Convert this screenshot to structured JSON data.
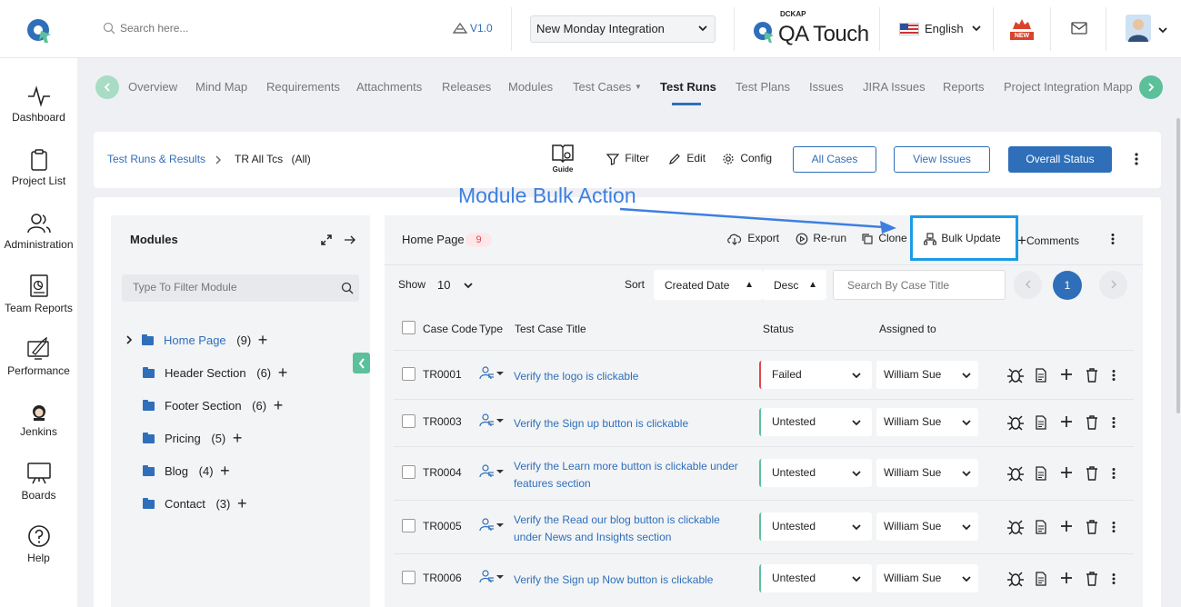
{
  "topbar": {
    "search_placeholder": "Search here...",
    "version": "V1.0",
    "project_select": "New Monday Integration",
    "brand_small": "DCKAP",
    "brand_name": "QA Touch",
    "language": "English",
    "new_badge": "NEW"
  },
  "sidebar": {
    "items": [
      {
        "label": "Dashboard",
        "icon": "pulse-icon"
      },
      {
        "label": "Project List",
        "icon": "clipboard-icon"
      },
      {
        "label": "Administration",
        "icon": "users-icon"
      },
      {
        "label": "Team Reports",
        "icon": "report-icon"
      },
      {
        "label": "Performance",
        "icon": "performance-icon"
      },
      {
        "label": "Jenkins",
        "icon": "jenkins-icon"
      },
      {
        "label": "Boards",
        "icon": "board-icon"
      },
      {
        "label": "Help",
        "icon": "help-icon"
      }
    ]
  },
  "tabs": [
    {
      "label": "Overview"
    },
    {
      "label": "Mind Map"
    },
    {
      "label": "Requirements"
    },
    {
      "label": "Attachments"
    },
    {
      "label": "Releases"
    },
    {
      "label": "Modules"
    },
    {
      "label": "Test Cases"
    },
    {
      "label": "Test Runs"
    },
    {
      "label": "Test Plans"
    },
    {
      "label": "Issues"
    },
    {
      "label": "JIRA Issues"
    },
    {
      "label": "Reports"
    },
    {
      "label": "Project Integration Mappin"
    }
  ],
  "header": {
    "breadcrumb_root": "Test Runs & Results",
    "breadcrumb_current": "TR All Tcs",
    "breadcrumb_filter": "(All)",
    "guide": "Guide",
    "filter": "Filter",
    "edit": "Edit",
    "config": "Config",
    "all_cases": "All Cases",
    "view_issues": "View Issues",
    "overall_status": "Overall Status"
  },
  "annotation": "Module Bulk Action",
  "modules": {
    "title": "Modules",
    "filter_placeholder": "Type To Filter Module",
    "items": [
      {
        "name": "Home Page",
        "count": "(9)"
      },
      {
        "name": "Header Section",
        "count": "(6)"
      },
      {
        "name": "Footer Section",
        "count": "(6)"
      },
      {
        "name": "Pricing",
        "count": "(5)"
      },
      {
        "name": "Blog",
        "count": "(4)"
      },
      {
        "name": "Contact",
        "count": "(3)"
      }
    ]
  },
  "table": {
    "module_title": "Home Page",
    "module_count": "9",
    "export": "Export",
    "rerun": "Re-run",
    "clone": "Clone",
    "bulk_update": "Bulk Update",
    "comments": "Comments",
    "show_label": "Show",
    "show_value": "10",
    "sort_label": "Sort",
    "sort_field": "Created Date",
    "sort_order": "Desc",
    "search_placeholder": "Search By Case Title",
    "page": "1",
    "columns": {
      "case_code": "Case Code",
      "type": "Type",
      "title": "Test Case Title",
      "status": "Status",
      "assigned": "Assigned to"
    },
    "rows": [
      {
        "code": "TR0001",
        "title1": "Verify the logo is clickable",
        "title2": "",
        "status": "Failed",
        "assigned": "William Sue"
      },
      {
        "code": "TR0003",
        "title1": "Verify the Sign up button is clickable",
        "title2": "",
        "status": "Untested",
        "assigned": "William Sue"
      },
      {
        "code": "TR0004",
        "title1": "Verify the Learn more button is clickable under",
        "title2": "features section",
        "status": "Untested",
        "assigned": "William Sue"
      },
      {
        "code": "TR0005",
        "title1": "Verify the Read our blog button is clickable",
        "title2": "under News and Insights section",
        "status": "Untested",
        "assigned": "William Sue"
      },
      {
        "code": "TR0006",
        "title1": "Verify the Sign up Now button is clickable",
        "title2": "",
        "status": "Untested",
        "assigned": "William Sue"
      }
    ]
  },
  "colors": {
    "primary": "#2f6fba",
    "accent_green": "#5cc09a",
    "failed_red": "#e04848",
    "annotation_blue": "#3d7fe0",
    "highlight_box": "#1a9be8"
  }
}
